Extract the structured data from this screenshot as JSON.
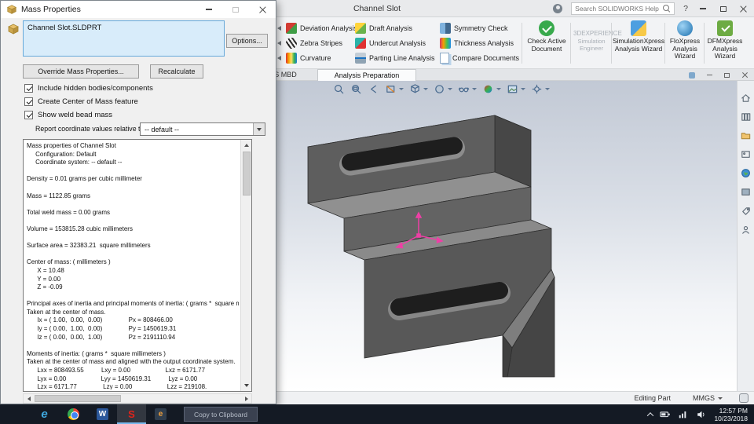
{
  "window": {
    "title": "Channel Slot",
    "search_placeholder": "Search SOLIDWORKS Help",
    "help_label": "?"
  },
  "ribbon": {
    "tabs": [
      {
        "label": "SOLIDWORKS MBD",
        "active": false
      },
      {
        "label": "Analysis Preparation",
        "active": true
      }
    ],
    "groups": [
      {
        "items": [
          {
            "label": "Deviation Analysis",
            "icon": "deviation-analysis-icon"
          },
          {
            "label": "Zebra Stripes",
            "icon": "zebra-stripes-icon"
          },
          {
            "label": "Curvature",
            "icon": "curvature-icon"
          }
        ]
      },
      {
        "items": [
          {
            "label": "Draft Analysis",
            "icon": "draft-analysis-icon"
          },
          {
            "label": "Undercut Analysis",
            "icon": "undercut-analysis-icon"
          },
          {
            "label": "Parting Line Analysis",
            "icon": "parting-line-analysis-icon"
          }
        ]
      },
      {
        "items": [
          {
            "label": "Symmetry Check",
            "icon": "symmetry-check-icon"
          },
          {
            "label": "Thickness Analysis",
            "icon": "thickness-analysis-icon"
          },
          {
            "label": "Compare Documents",
            "icon": "compare-documents-icon"
          }
        ]
      }
    ],
    "big_buttons": [
      {
        "label": "Check Active Document",
        "icon": "check-active-document-icon"
      },
      {
        "label": "SimulationXpress Analysis Wizard",
        "icon": "simulationxpress-wizard-icon"
      },
      {
        "label": "FloXpress Analysis Wizard",
        "icon": "floxpress-wizard-icon"
      },
      {
        "label": "DFMXpress Analysis Wizard",
        "icon": "dfmxpress-wizard-icon"
      }
    ],
    "disabled_button": {
      "line1": "3DEXPERIENCE",
      "line2": "Simulation",
      "line3": "Engineer"
    }
  },
  "dialog": {
    "title": "Mass Properties",
    "document": "Channel Slot.SLDPRT",
    "options_button": "Options...",
    "override_button": "Override Mass Properties...",
    "recalculate_button": "Recalculate",
    "checkboxes": [
      {
        "label": "Include hidden bodies/components",
        "checked": true
      },
      {
        "label": "Create Center of Mass feature",
        "checked": true
      },
      {
        "label": "Show weld bead mass",
        "checked": true
      }
    ],
    "report_label": "Report coordinate values relative to:",
    "report_value": "-- default --",
    "results_text": "Mass properties of Channel Slot\n     Configuration: Default\n     Coordinate system: -- default --\n\nDensity = 0.01 grams per cubic millimeter\n\nMass = 1122.85 grams\n\nTotal weld mass = 0.00 grams\n\nVolume = 153815.28 cubic millimeters\n\nSurface area = 32383.21  square millimeters\n\nCenter of mass: ( millimeters )\n      X = 10.48\n      Y = 0.00\n      Z = -0.09\n\nPrincipal axes of inertia and principal moments of inertia: ( grams *  square millimeters )\nTaken at the center of mass.\n      Ix = ( 1.00,  0.00,  0.00)               Px = 808466.00\n      Iy = ( 0.00,  1.00,  0.00)               Py = 1450619.31\n      Iz = ( 0.00,  0.00,  1.00)               Pz = 2191110.94\n\nMoments of inertia: ( grams *  square millimeters )\nTaken at the center of mass and aligned with the output coordinate system.\n      Lxx = 808493.55          Lxy = 0.00                    Lxz = 6171.77\n      Lyx = 0.00                    Lyy = 1450619.31          Lyz = 0.00\n      Lzx = 6171.77               Lzy = 0.00                    Lzz = 219108.",
    "copy_button": "Copy to Clipboard"
  },
  "statusbar": {
    "mode": "Editing Part",
    "units": "MMGS"
  },
  "taskbar": {
    "apps": [
      {
        "name": "edge",
        "glyph": "e"
      },
      {
        "name": "chrome",
        "glyph": ""
      },
      {
        "name": "word",
        "glyph": "W"
      },
      {
        "name": "solidworks",
        "glyph": "S",
        "active": true
      },
      {
        "name": "edrawings",
        "glyph": "e"
      }
    ],
    "clock_time": "12:57 PM",
    "clock_date": "10/23/2018"
  },
  "colors": {
    "accent_blue": "#0078d7",
    "part_gray": "#5e5e5e",
    "com_triad_pink": "#ee3fa6",
    "check_green": "#38a94c",
    "taskbar_dark": "#141a24"
  }
}
